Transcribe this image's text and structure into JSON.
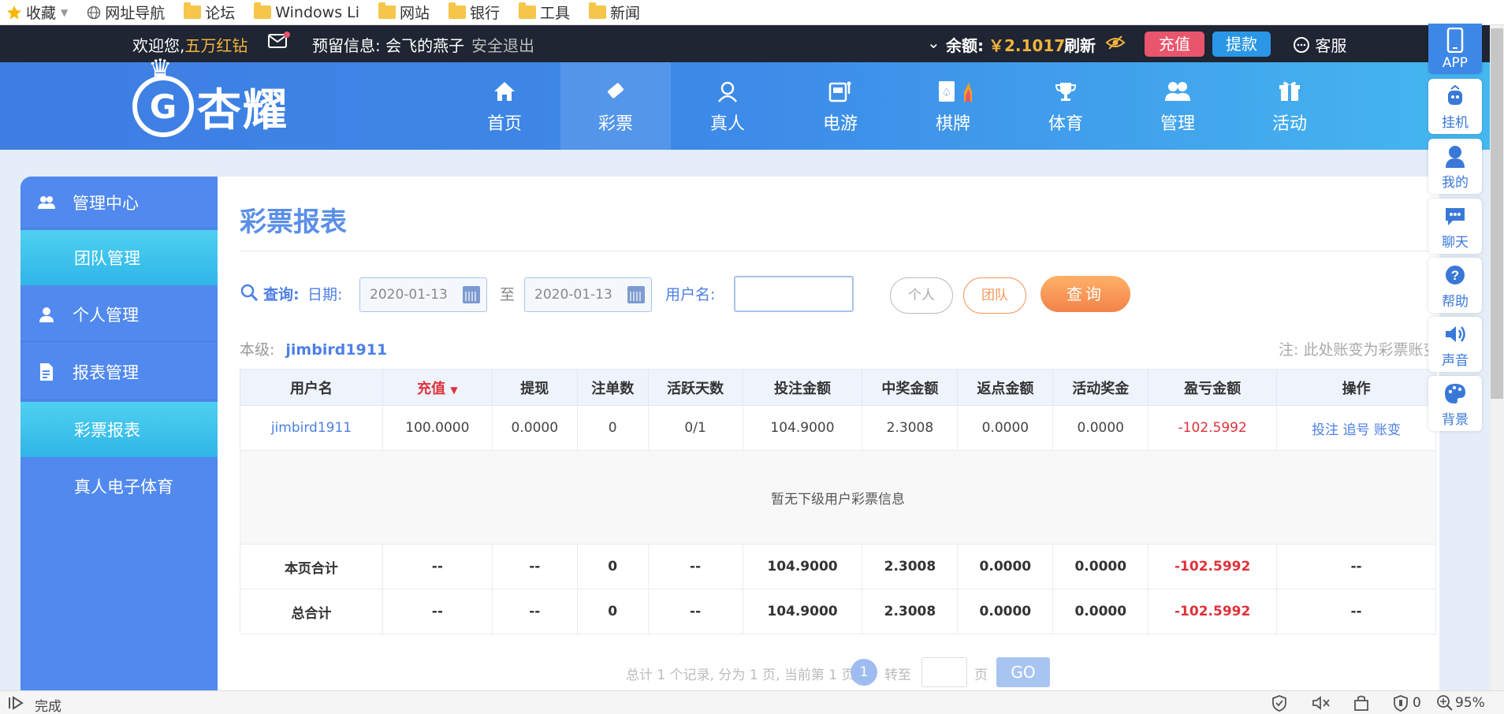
{
  "bookmarks": [
    {
      "label": "收藏",
      "icon": "star-icon"
    },
    {
      "label": "网址导航",
      "icon": "globe-icon"
    },
    {
      "label": "论坛",
      "icon": "folder-icon"
    },
    {
      "label": "Windows Li",
      "icon": "folder-icon"
    },
    {
      "label": "网站",
      "icon": "folder-icon"
    },
    {
      "label": "银行",
      "icon": "folder-icon"
    },
    {
      "label": "工具",
      "icon": "folder-icon"
    },
    {
      "label": "新闻",
      "icon": "folder-icon"
    }
  ],
  "topbar": {
    "welcome": "欢迎您,",
    "username": "五万红钻",
    "reserved_label": "预留信息:",
    "reserved_value": "会飞的燕子",
    "logout": "安全退出",
    "balance_label": "余额:",
    "balance_value": "￥2.1017",
    "refresh": "刷新",
    "recharge": "充值",
    "withdraw": "提款",
    "service": "客服"
  },
  "logo": {
    "text": "杏耀",
    "mark": "G"
  },
  "nav": [
    {
      "label": "首页",
      "icon": "home-icon"
    },
    {
      "label": "彩票",
      "icon": "ticket-icon"
    },
    {
      "label": "真人",
      "icon": "dealer-icon"
    },
    {
      "label": "电游",
      "icon": "slot-machine-icon"
    },
    {
      "label": "棋牌",
      "icon": "cards-icon"
    },
    {
      "label": "体育",
      "icon": "trophy-icon"
    },
    {
      "label": "管理",
      "icon": "users-icon"
    },
    {
      "label": "活动",
      "icon": "gift-icon"
    }
  ],
  "sidebar": {
    "items": [
      {
        "label": "管理中心",
        "icon": "users-icon"
      },
      {
        "label": "团队管理"
      },
      {
        "label": "个人管理",
        "icon": "user-icon"
      },
      {
        "label": "报表管理",
        "icon": "report-icon"
      },
      {
        "label": "彩票报表"
      },
      {
        "label": "真人电子体育"
      }
    ]
  },
  "content": {
    "title": "彩票报表",
    "query_label": "查询:",
    "date_label": "日期:",
    "date_from": "2020-01-13",
    "to_label": "至",
    "date_to": "2020-01-13",
    "username_label": "用户名:",
    "username_value": "",
    "personal_btn": "个人",
    "team_btn": "团队",
    "search_btn": "查询",
    "level_label": "本级:",
    "level_user": "jimbird1911",
    "note": "注: 此处账变为彩票账变"
  },
  "table": {
    "headers": [
      "用户名",
      "充值",
      "提现",
      "注单数",
      "活跃天数",
      "投注金额",
      "中奖金额",
      "返点金额",
      "活动奖金",
      "盈亏金额",
      "操作"
    ],
    "sort_arrow": "▼",
    "row": {
      "user": "jimbird1911",
      "recharge": "100.0000",
      "withdraw": "0.0000",
      "orders": "0",
      "active_days": "0/1",
      "bet": "104.9000",
      "win": "2.3008",
      "rebate": "0.0000",
      "bonus": "0.0000",
      "profit": "-102.5992",
      "actions": [
        "投注",
        "追号",
        "账变"
      ]
    },
    "empty_text": "暂无下级用户彩票信息",
    "page_total": {
      "label": "本页合计",
      "recharge": "--",
      "withdraw": "--",
      "orders": "0",
      "active_days": "--",
      "bet": "104.9000",
      "win": "2.3008",
      "rebate": "0.0000",
      "bonus": "0.0000",
      "profit": "-102.5992",
      "actions": "--"
    },
    "grand_total": {
      "label": "总合计",
      "recharge": "--",
      "withdraw": "--",
      "orders": "0",
      "active_days": "--",
      "bet": "104.9000",
      "win": "2.3008",
      "rebate": "0.0000",
      "bonus": "0.0000",
      "profit": "-102.5992",
      "actions": "--"
    }
  },
  "pager": {
    "summary": "总计 1 个记录, 分为 1 页, 当前第 1 页",
    "current": "1",
    "goto": "转至",
    "page_unit": "页",
    "go": "GO"
  },
  "right_tools": [
    {
      "label": "APP",
      "icon": "phone-icon"
    },
    {
      "label": "挂机",
      "icon": "robot-icon"
    },
    {
      "label": "我的",
      "icon": "user-icon"
    },
    {
      "label": "聊天",
      "icon": "chat-icon"
    },
    {
      "label": "帮助",
      "icon": "help-icon"
    },
    {
      "label": "声音",
      "icon": "speaker-icon"
    },
    {
      "label": "背景",
      "icon": "palette-icon"
    }
  ],
  "statusbar": {
    "status": "完成",
    "count": "0",
    "zoom": "95%"
  },
  "colors": {
    "accent": "#4d80e5",
    "negative": "#e0313a",
    "gold": "#f3b33d",
    "sidebar": "#5189ee"
  }
}
